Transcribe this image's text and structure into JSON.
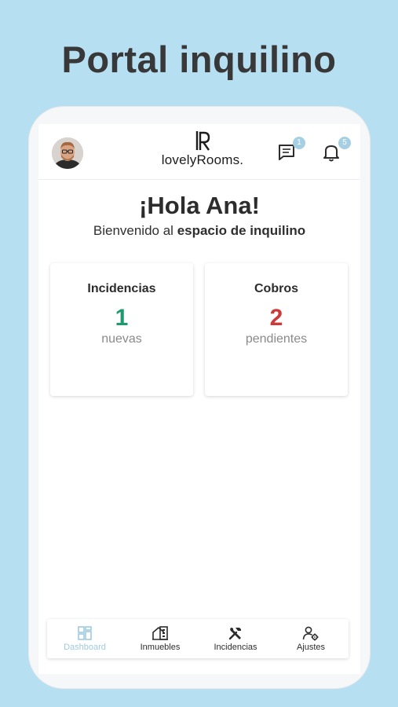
{
  "promo": {
    "title": "Portal inquilino"
  },
  "header": {
    "logo_text": "lovelyRooms.",
    "messages_badge": "1",
    "notifications_badge": "5"
  },
  "greeting": {
    "title": "¡Hola Ana!",
    "welcome_prefix": "Bienvenido al ",
    "welcome_bold": "espacio de inquilino"
  },
  "cards": [
    {
      "title": "Incidencias",
      "value": "1",
      "subtitle": "nuevas",
      "color": "#1e9a6d"
    },
    {
      "title": "Cobros",
      "value": "2",
      "subtitle": "pendientes",
      "color": "#cc3b3b"
    }
  ],
  "nav": [
    {
      "label": "Dashboard",
      "icon": "dashboard-icon",
      "active": true
    },
    {
      "label": "Inmuebles",
      "icon": "building-icon",
      "active": false
    },
    {
      "label": "Incidencias",
      "icon": "tools-icon",
      "active": false
    },
    {
      "label": "Ajustes",
      "icon": "user-settings-icon",
      "active": false
    }
  ],
  "colors": {
    "background": "#b7dff2",
    "accent": "#9fcbe0",
    "badge": "#a7cfe3"
  }
}
